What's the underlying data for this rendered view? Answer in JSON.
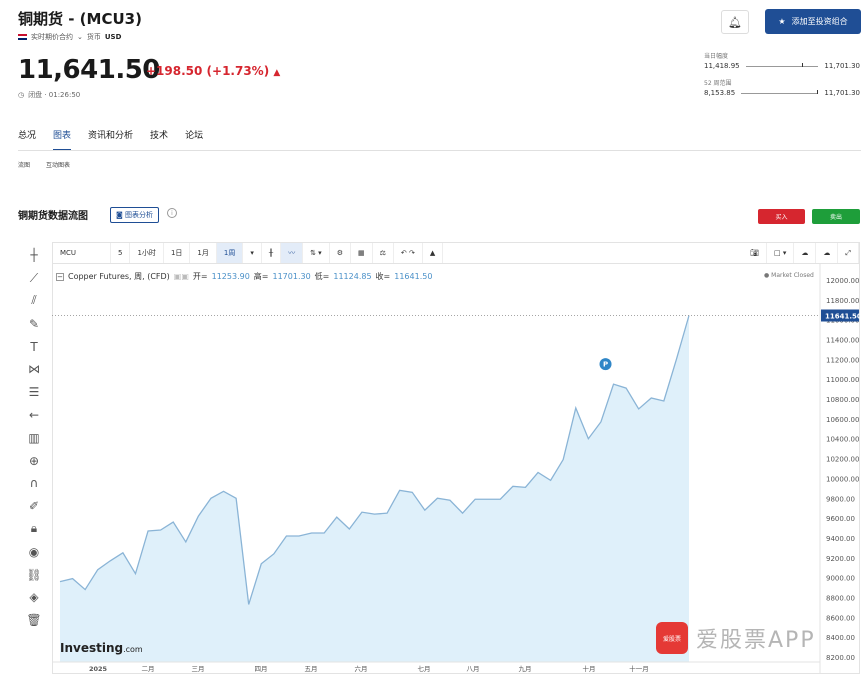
{
  "header": {
    "title": "铜期货 - (MCU3)",
    "contract_type": "实时期价合约",
    "currency_label": "货币",
    "currency": "USD",
    "price": "11,641.50",
    "change": "+198.50 (+1.73%)",
    "status": "闭盘 · 01:26:50",
    "add_portfolio": "添加至投资组合"
  },
  "ranges": {
    "day_label": "当日幅度",
    "day_low": "11,418.95",
    "day_high": "11,701.30",
    "day_pos": 0.78,
    "week52_label": "52 周范围",
    "week52_low": "8,153.85",
    "week52_high": "11,701.30",
    "week52_pos": 0.98
  },
  "tabs": [
    "总况",
    "图表",
    "资讯和分析",
    "技术",
    "论坛"
  ],
  "subtabs": [
    "流图",
    "互动图表"
  ],
  "section": {
    "title": "铜期货数据流图",
    "chart_analysis": "图表分析",
    "buy": "买入",
    "sell": "卖出"
  },
  "chart_toolbar": {
    "symbol": "MCU",
    "intervals": [
      "5",
      "1小时",
      "1日",
      "1月",
      "1周"
    ]
  },
  "legend": {
    "name": "Copper Futures, 周, (CFD)",
    "open_label": "开=",
    "open": "11253.90",
    "high_label": "高=",
    "high": "11701.30",
    "low_label": "低=",
    "low": "11124.85",
    "close_label": "收=",
    "close": "11641.50",
    "market_closed": "Market Closed"
  },
  "branding": {
    "logo": "Investing",
    "logo_suffix": ".com",
    "watermark_icon": "爱股票",
    "watermark_text": "爱股票APP"
  },
  "colors": {
    "accent": "#1f4e95",
    "up": "#d6262f",
    "buy": "#d6262f",
    "sell": "#1e9e3a",
    "line": "#8ab4d6",
    "fill": "#dff0fa"
  },
  "chart_data": {
    "type": "area",
    "x_ticks": [
      "2025",
      "二月",
      "三月",
      "四月",
      "五月",
      "六月",
      "七月",
      "八月",
      "九月",
      "十月",
      "十一月"
    ],
    "y_ticks": [
      12000,
      11800,
      11600,
      11400,
      11200,
      11000,
      10800,
      10600,
      10400,
      10200,
      10000,
      9800,
      9600,
      9400,
      9200,
      9000,
      8800,
      8600,
      8400,
      8200
    ],
    "ylim": [
      8150,
      12100
    ],
    "last_price_label": "11641.50",
    "values": [
      8960,
      8990,
      8880,
      9080,
      9170,
      9250,
      9040,
      9470,
      9480,
      9560,
      9360,
      9620,
      9800,
      9870,
      9800,
      8730,
      9140,
      9240,
      9420,
      9420,
      9450,
      9450,
      9610,
      9490,
      9660,
      9640,
      9650,
      9880,
      9860,
      9680,
      9800,
      9780,
      9650,
      9790,
      9790,
      9790,
      9920,
      9910,
      10060,
      9980,
      10190,
      10710,
      10400,
      10570,
      10950,
      10910,
      10700,
      10810,
      10780,
      11200,
      11641.5
    ],
    "annotation": "P",
    "annotation_index": 44
  }
}
